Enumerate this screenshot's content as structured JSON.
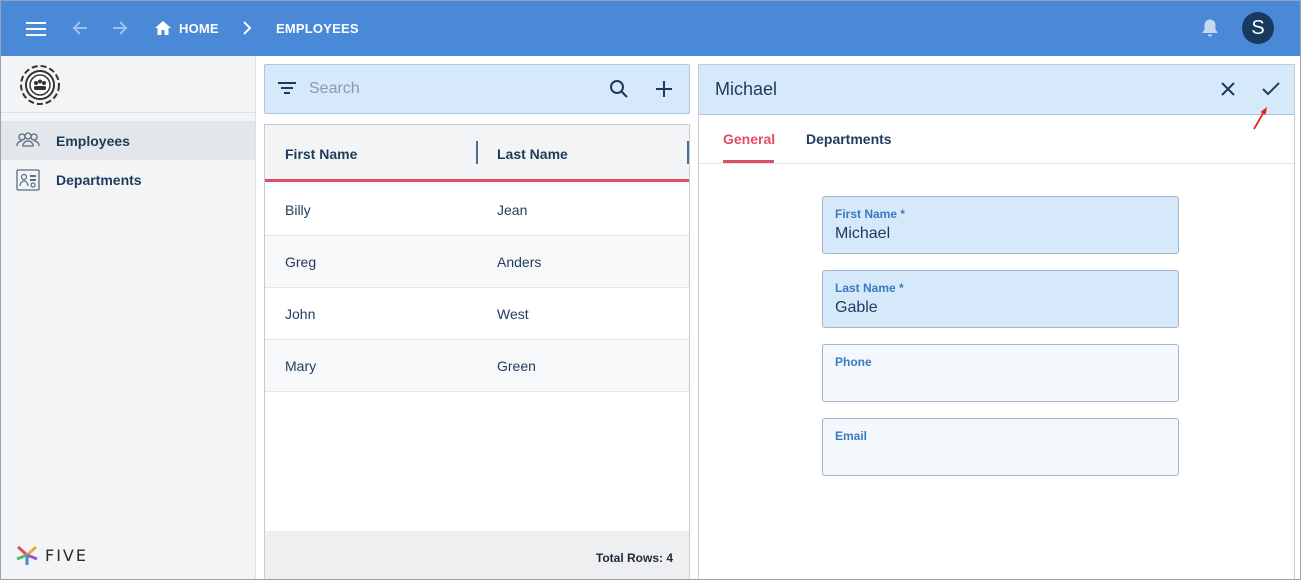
{
  "topbar": {
    "breadcrumb_home": "HOME",
    "breadcrumb_current": "EMPLOYEES",
    "avatar_initial": "S",
    "bar_color": "#4a88d8"
  },
  "sidebar": {
    "items": [
      {
        "label": "Employees",
        "icon": "users-group-icon",
        "active": true
      },
      {
        "label": "Departments",
        "icon": "department-board-icon",
        "active": false
      }
    ],
    "brand": "FIVE"
  },
  "list": {
    "search_placeholder": "Search",
    "columns": [
      "First Name",
      "Last Name"
    ],
    "rows": [
      {
        "first": "Billy",
        "last": "Jean"
      },
      {
        "first": "Greg",
        "last": "Anders"
      },
      {
        "first": "John",
        "last": "West"
      },
      {
        "first": "Mary",
        "last": "Green"
      }
    ],
    "footer": "Total Rows: 4"
  },
  "form": {
    "title": "Michael",
    "tabs": [
      "General",
      "Departments"
    ],
    "active_tab": "General",
    "fields": [
      {
        "label": "First Name *",
        "value": "Michael"
      },
      {
        "label": "Last Name *",
        "value": "Gable"
      },
      {
        "label": "Phone",
        "value": ""
      },
      {
        "label": "Email",
        "value": ""
      }
    ]
  },
  "colors": {
    "accent": "#e04e66",
    "panel_header": "#d6e9fb",
    "text_dark": "#1f3b5c"
  }
}
